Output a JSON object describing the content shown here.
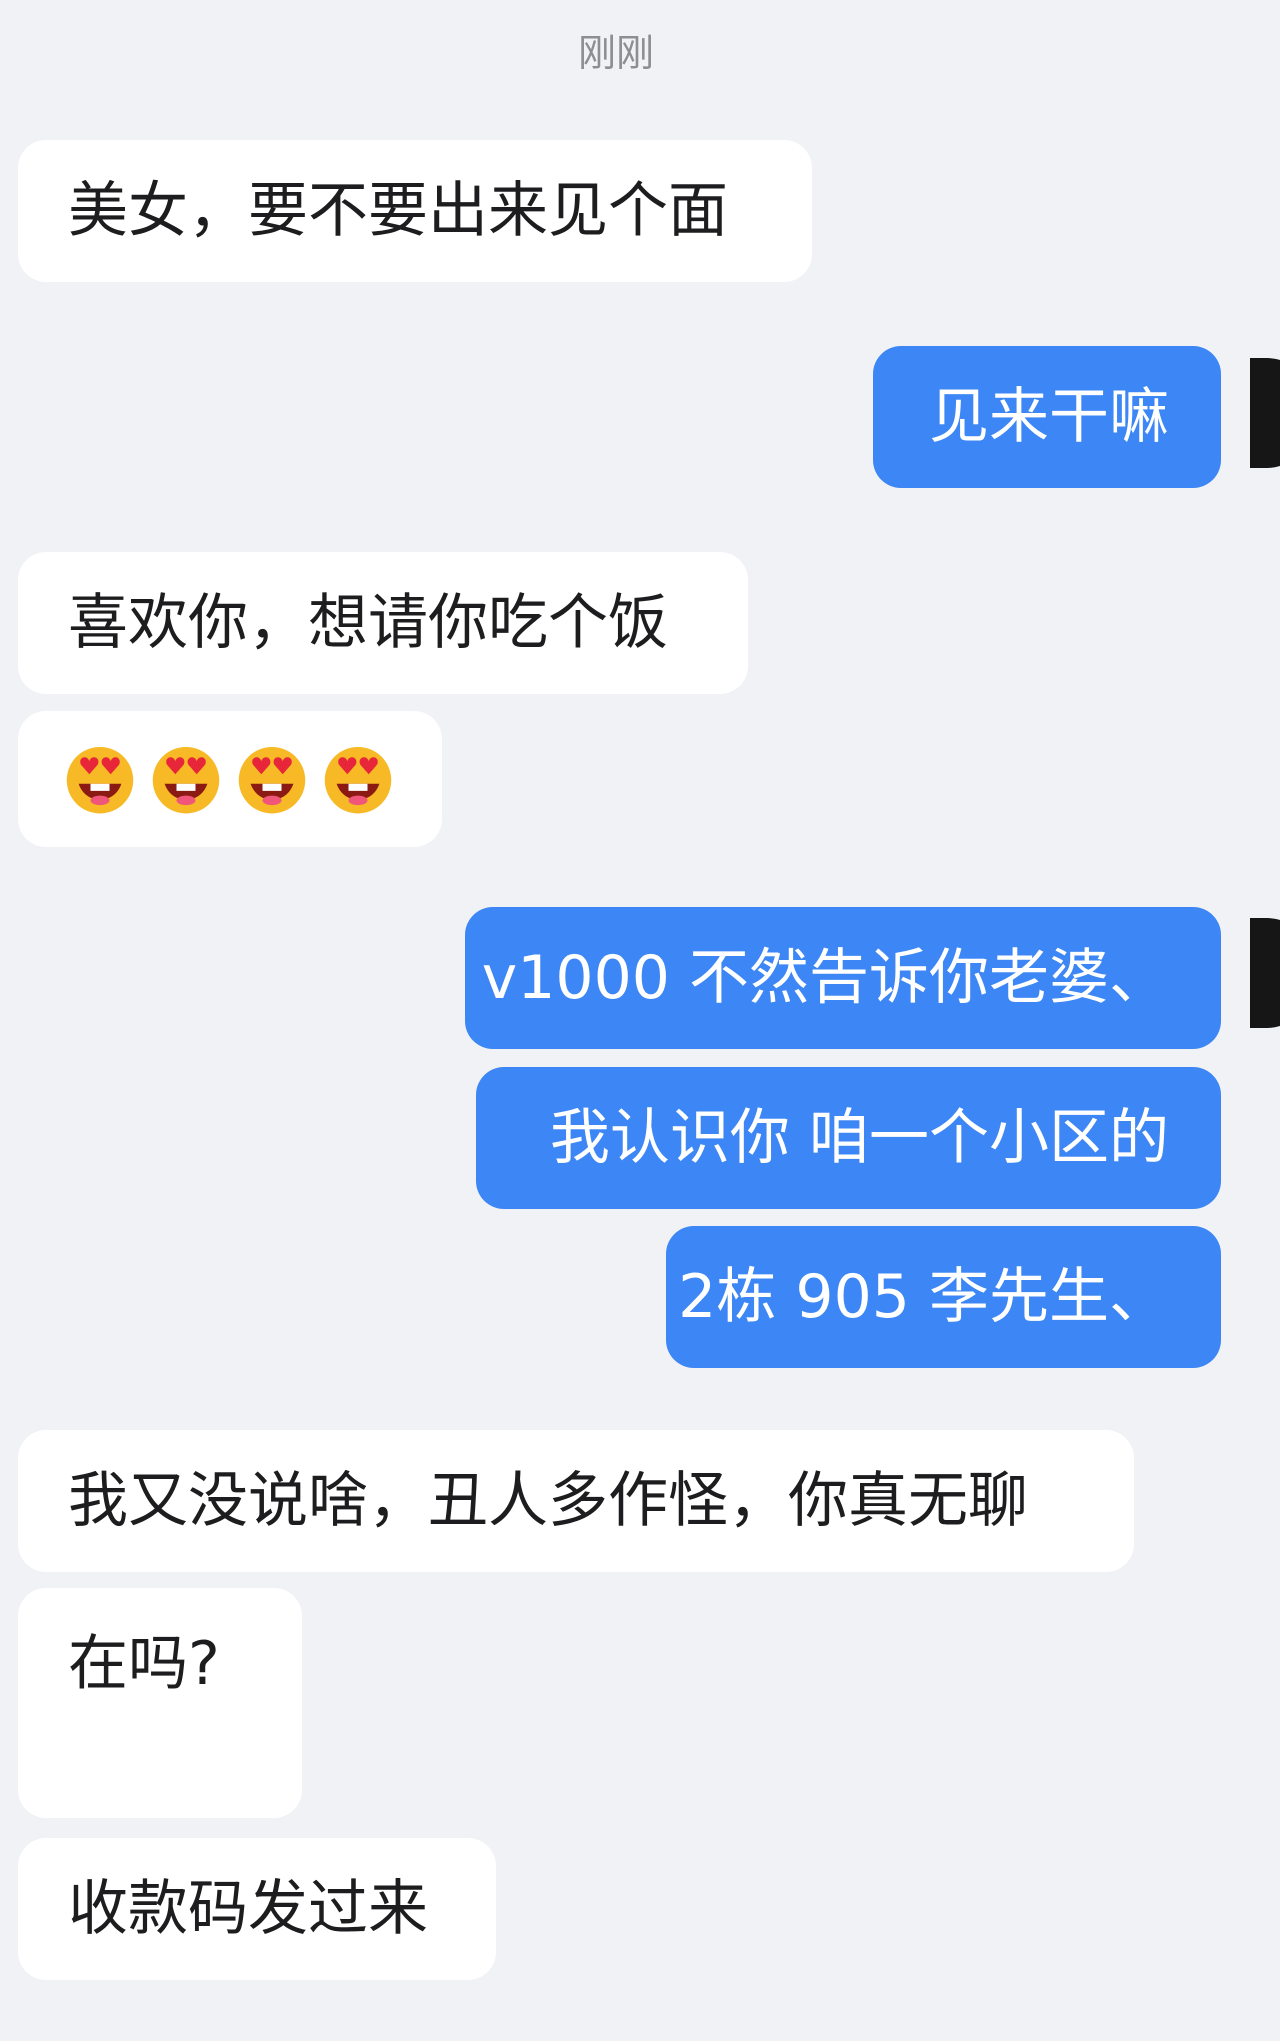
{
  "timestamp": "刚刚",
  "messages": [
    {
      "side": "in",
      "text": "美女，要不要出来见个面"
    },
    {
      "side": "out",
      "text": "见来干嘛"
    },
    {
      "side": "in",
      "text": "喜欢你，想请你吃个饭"
    },
    {
      "side": "in",
      "emoji": "heart-eyes-face",
      "emoji_count": 4
    },
    {
      "side": "out",
      "text": "v1000 不然告诉你老婆、"
    },
    {
      "side": "out",
      "text": "我认识你 咱一个小区的"
    },
    {
      "side": "out",
      "text": "2栋 905 李先生、"
    },
    {
      "side": "in",
      "text": "我又没说啥，丑人多作怪，你真无聊"
    },
    {
      "side": "in",
      "text": "在吗?"
    },
    {
      "side": "in",
      "text": "收款码发过来"
    }
  ],
  "colors": {
    "background": "#f1f2f6",
    "incoming_bubble": "#ffffff",
    "outgoing_bubble": "#3d86f5",
    "avatar": "#161616"
  }
}
